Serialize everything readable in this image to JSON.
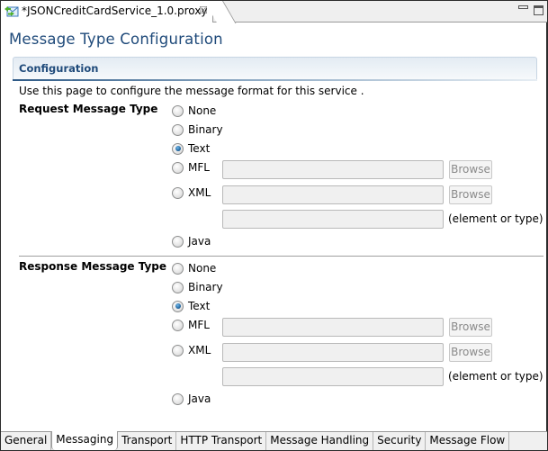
{
  "editor_tab": {
    "title": "*JSONCreditCardService_1.0.proxy",
    "icon": "proxy-service-icon",
    "close_glyph": "☒"
  },
  "window_controls": {
    "minimize": "minimize-icon",
    "maximize": "maximize-icon"
  },
  "page": {
    "title": "Message Type Configuration"
  },
  "section": {
    "title": "Configuration",
    "intro": "Use this page to configure the message format for this service ."
  },
  "request": {
    "label": "Request Message Type",
    "options": [
      {
        "label": "None",
        "checked": false
      },
      {
        "label": "Binary",
        "checked": false
      },
      {
        "label": "Text",
        "checked": true
      },
      {
        "label": "MFL",
        "checked": false
      },
      {
        "label": "XML",
        "checked": false
      },
      {
        "label": "Java",
        "checked": false
      }
    ],
    "mfl_value": "",
    "xml_value": "",
    "xml_element_value": "",
    "browse_label": "Browse",
    "element_hint": "(element or type)"
  },
  "response": {
    "label": "Response Message Type",
    "options": [
      {
        "label": "None",
        "checked": false
      },
      {
        "label": "Binary",
        "checked": false
      },
      {
        "label": "Text",
        "checked": true
      },
      {
        "label": "MFL",
        "checked": false
      },
      {
        "label": "XML",
        "checked": false
      },
      {
        "label": "Java",
        "checked": false
      }
    ],
    "mfl_value": "",
    "xml_value": "",
    "xml_element_value": "",
    "browse_label": "Browse",
    "element_hint": "(element or type)"
  },
  "bottom_tabs": [
    {
      "label": "General",
      "active": false
    },
    {
      "label": "Messaging",
      "active": true
    },
    {
      "label": "Transport",
      "active": false
    },
    {
      "label": "HTTP Transport",
      "active": false
    },
    {
      "label": "Message Handling",
      "active": false
    },
    {
      "label": "Security",
      "active": false
    },
    {
      "label": "Message Flow",
      "active": false
    }
  ]
}
